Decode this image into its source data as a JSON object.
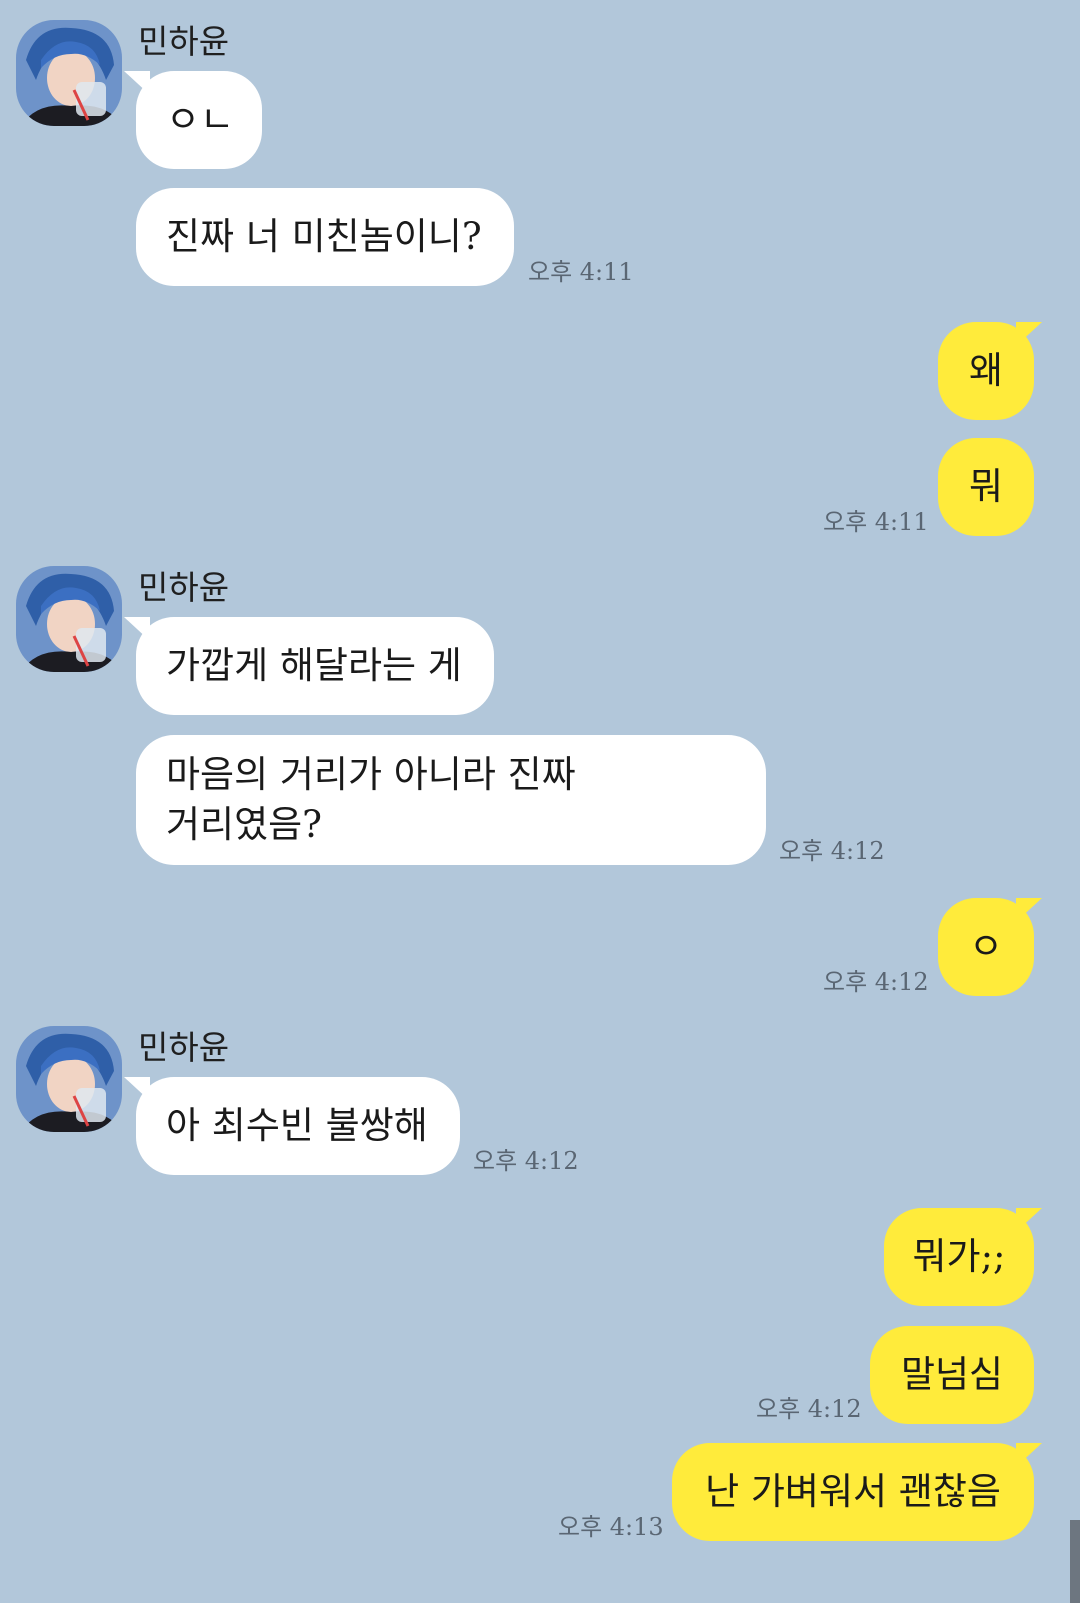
{
  "contact": {
    "name": "민하윤"
  },
  "messages": [
    {
      "text": "ㅇㄴ"
    },
    {
      "text": "진짜 너 미친놈이니?",
      "time": "오후 4:11"
    },
    {
      "text": "왜"
    },
    {
      "text": "뭐",
      "time": "오후 4:11"
    },
    {
      "text": "가깝게 해달라는 게"
    },
    {
      "line1": "마음의 거리가 아니라 진짜",
      "line2": "거리였음?",
      "time": "오후 4:12"
    },
    {
      "text": "ㅇ",
      "time": "오후 4:12"
    },
    {
      "text": "아 최수빈 불쌍해",
      "time": "오후 4:12"
    },
    {
      "text": "뭐가;;"
    },
    {
      "text": "말넘심",
      "time": "오후 4:12"
    },
    {
      "text": "난 가벼워서 괜찮음",
      "time": "오후 4:13"
    }
  ],
  "colors": {
    "background": "#b2c7da",
    "incoming": "#ffffff",
    "outgoing": "#ffeb3b"
  },
  "icons": {
    "avatar": "profile-photo"
  }
}
